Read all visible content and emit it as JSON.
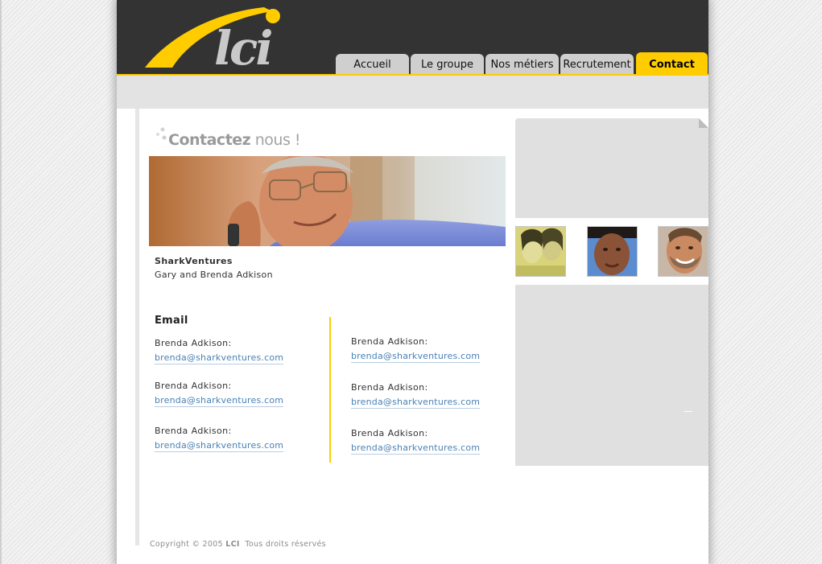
{
  "brand": {
    "logo_text": "lci"
  },
  "nav": {
    "tabs": [
      {
        "label": "Accueil"
      },
      {
        "label": "Le groupe"
      },
      {
        "label": "Nos métiers"
      },
      {
        "label": "Recrutement"
      },
      {
        "label": "Contact",
        "active": true
      }
    ]
  },
  "page": {
    "title_bold": "Contactez",
    "title_rest": " nous  !",
    "company": "SharkVentures",
    "names": "Gary and Brenda Adkison",
    "email_heading": "Email"
  },
  "contacts_left": [
    {
      "label": "Brenda Adkison:",
      "email": "brenda@sharkventures.com"
    },
    {
      "label": "Brenda Adkison:",
      "email": "brenda@sharkventures.com"
    },
    {
      "label": "Brenda Adkison:",
      "email": "brenda@sharkventures.com"
    }
  ],
  "contacts_right": [
    {
      "label": "Brenda Adkison:",
      "email": "brenda@sharkventures.com"
    },
    {
      "label": "Brenda Adkison:",
      "email": "brenda@sharkventures.com"
    },
    {
      "label": "Brenda Adkison:",
      "email": "brenda@sharkventures.com"
    }
  ],
  "footer": {
    "copyright_prefix": "Copyright © 2005 ",
    "copyright_brand": "LCI",
    "copyright_suffix": "  Tous droits réservés"
  },
  "colors": {
    "accent": "#ffcc00",
    "header": "#333333",
    "link": "#4a82b4",
    "panel": "#e0e0e0"
  }
}
